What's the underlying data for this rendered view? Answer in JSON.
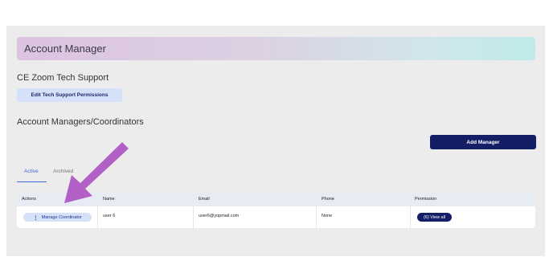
{
  "header": {
    "title": "Account Manager"
  },
  "tech_support": {
    "title": "CE Zoom Tech Support",
    "edit_button_label": "Edit Tech Support Permissions"
  },
  "managers": {
    "title": "Account Managers/Coordinators",
    "add_button_label": "Add Manager",
    "tabs": [
      {
        "label": "Active",
        "selected": true
      },
      {
        "label": "Archived",
        "selected": false
      }
    ]
  },
  "table": {
    "columns": [
      "Actions",
      "Name",
      "Email",
      "Phone",
      "Permission"
    ],
    "rows": [
      {
        "action_label": "Manage Coordinator",
        "name": "user 6",
        "email": "user6@yopmail.com",
        "phone": "None",
        "permission_label": "(6) View all"
      }
    ]
  },
  "colors": {
    "accent": "#3f6ad8",
    "primary_button": "#131e66",
    "light_button": "#d5e1f8",
    "arrow": "#b25fc6"
  },
  "icons": {
    "action_menu": "vertical-dots-icon",
    "annotation": "arrow-pointer-icon"
  }
}
